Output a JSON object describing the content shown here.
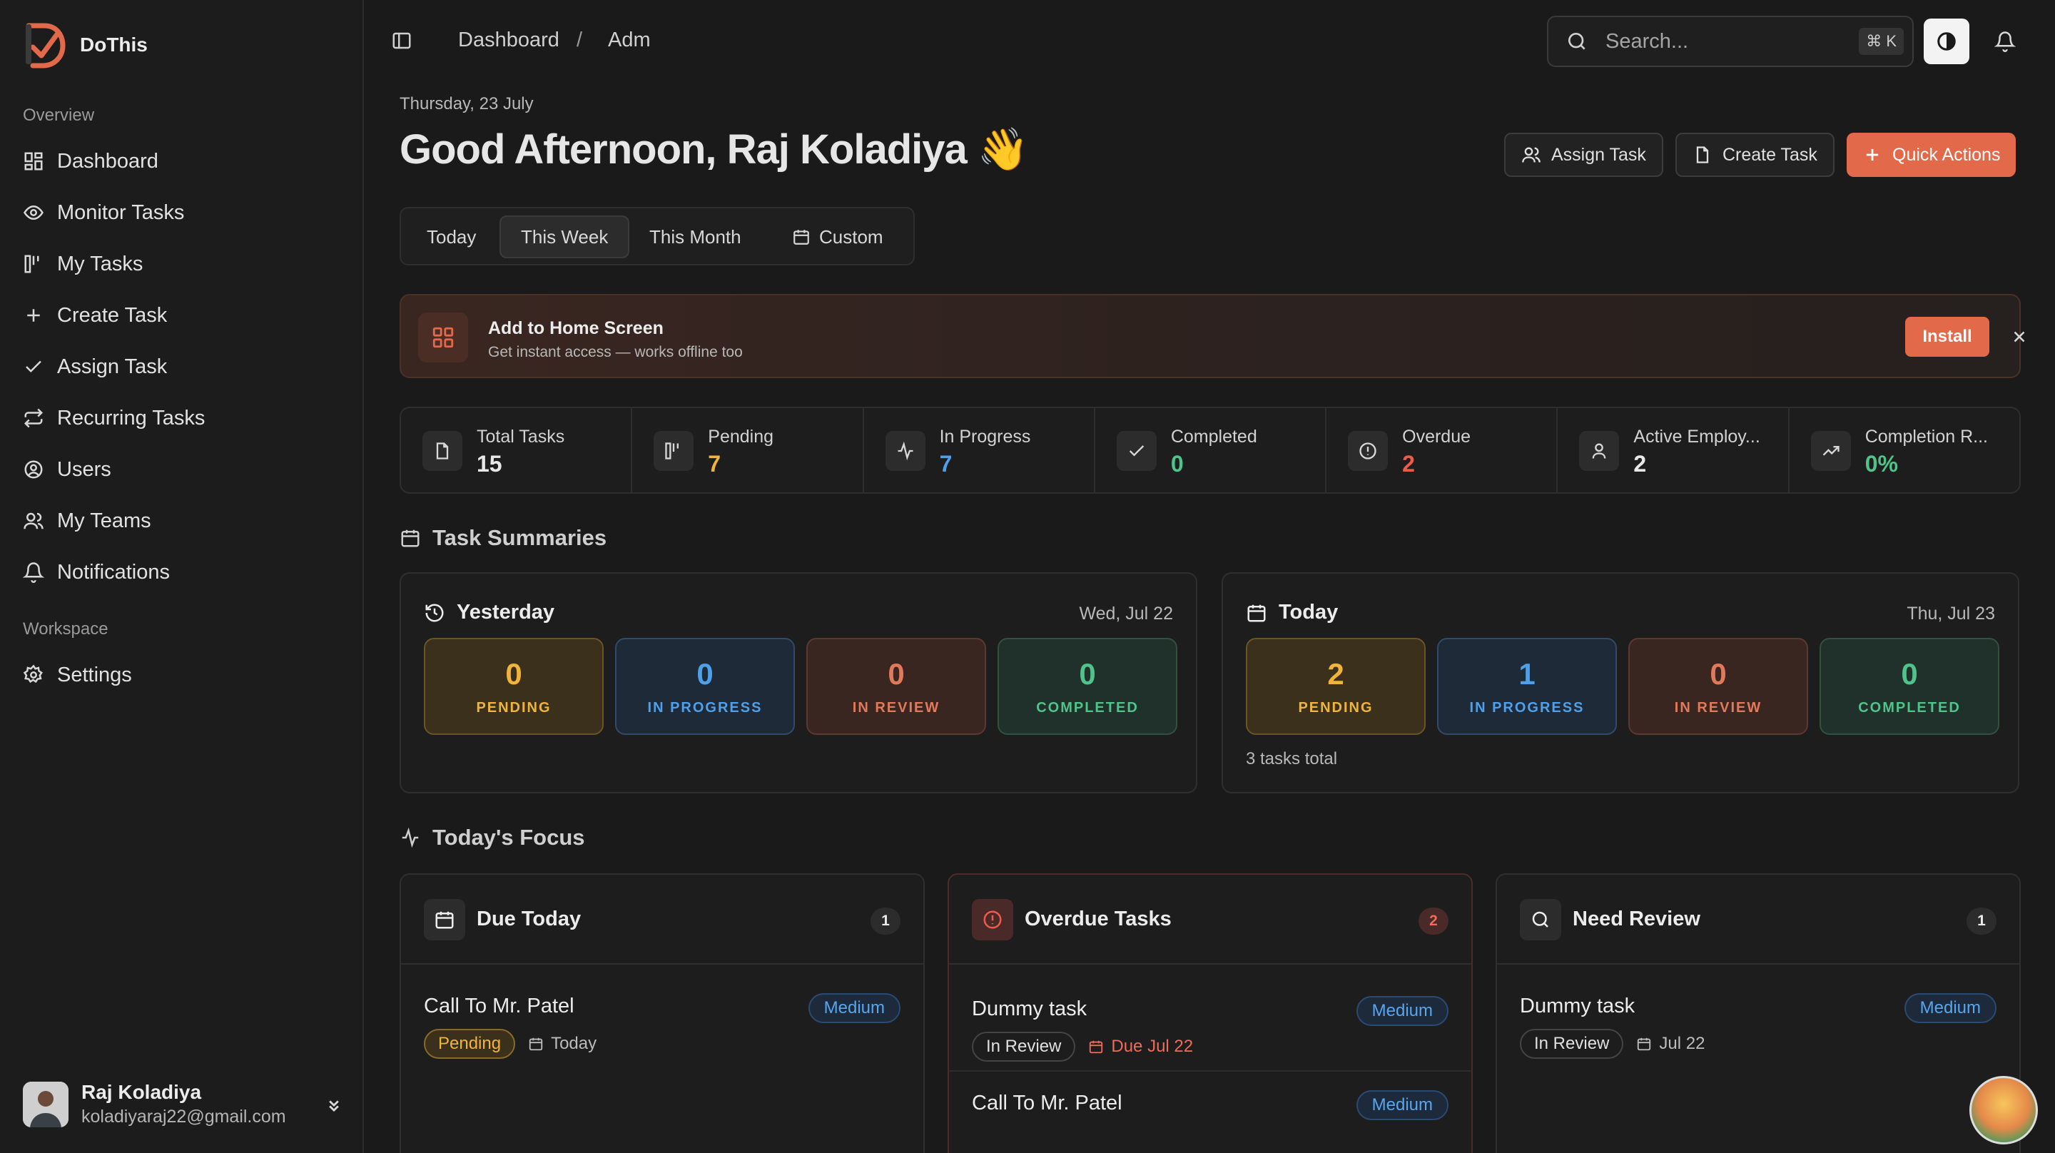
{
  "app": {
    "name": "DoThis",
    "brand_color": "#e3694b"
  },
  "sidebar": {
    "overview_label": "Overview",
    "workspace_label": "Workspace",
    "items": [
      {
        "label": "Dashboard",
        "icon": "dashboard-icon"
      },
      {
        "label": "Monitor Tasks",
        "icon": "eye-icon"
      },
      {
        "label": "My Tasks",
        "icon": "kanban-icon"
      },
      {
        "label": "Create Task",
        "icon": "plus-icon"
      },
      {
        "label": "Assign Task",
        "icon": "check-icon"
      },
      {
        "label": "Recurring Tasks",
        "icon": "repeat-icon"
      },
      {
        "label": "Users",
        "icon": "user-circle-icon"
      },
      {
        "label": "My Teams",
        "icon": "users-icon"
      },
      {
        "label": "Notifications",
        "icon": "bell-icon"
      }
    ],
    "workspace_items": [
      {
        "label": "Settings",
        "icon": "gear-icon"
      }
    ],
    "user": {
      "name": "Raj Koladiya",
      "email": "koladiyaraj22@gmail.com"
    }
  },
  "topbar": {
    "breadcrumb": [
      "Dashboard",
      "/",
      "Adm"
    ],
    "search_placeholder": "Search...",
    "shortcut": "⌘ K"
  },
  "header": {
    "date": "Thursday, 23 July",
    "greeting": "Good Afternoon, Raj Koladiya 👋",
    "assign_label": "Assign Task",
    "create_label": "Create Task",
    "quick_label": "Quick Actions"
  },
  "tabs": {
    "items": [
      "Today",
      "This Week",
      "This Month",
      "Custom"
    ],
    "active": "This Week"
  },
  "pwa": {
    "title": "Add to Home Screen",
    "subtitle": "Get instant access — works offline too",
    "install_label": "Install"
  },
  "stats": [
    {
      "label": "Total Tasks",
      "value": "15",
      "color": "#e8e8e8"
    },
    {
      "label": "Pending",
      "value": "7",
      "color": "#f0b43a"
    },
    {
      "label": "In Progress",
      "value": "7",
      "color": "#4fa0ea"
    },
    {
      "label": "Completed",
      "value": "0",
      "color": "#4fc48a"
    },
    {
      "label": "Overdue",
      "value": "2",
      "color": "#ef5b4a"
    },
    {
      "label": "Active Employ...",
      "value": "2",
      "color": "#e8e8e8"
    },
    {
      "label": "Completion R...",
      "value": "0%",
      "color": "#4fc48a"
    }
  ],
  "summaries": {
    "title": "Task Summaries",
    "yesterday": {
      "title": "Yesterday",
      "date": "Wed, Jul 22",
      "tiles": [
        {
          "num": "0",
          "label": "PENDING"
        },
        {
          "num": "0",
          "label": "IN PROGRESS"
        },
        {
          "num": "0",
          "label": "IN REVIEW"
        },
        {
          "num": "0",
          "label": "COMPLETED"
        }
      ]
    },
    "today": {
      "title": "Today",
      "date": "Thu, Jul 23",
      "tiles": [
        {
          "num": "2",
          "label": "PENDING"
        },
        {
          "num": "1",
          "label": "IN PROGRESS"
        },
        {
          "num": "0",
          "label": "IN REVIEW"
        },
        {
          "num": "0",
          "label": "COMPLETED"
        }
      ],
      "footer": "3 tasks total"
    }
  },
  "focus": {
    "title": "Today's Focus",
    "due_today": {
      "title": "Due Today",
      "count": "1",
      "tasks": [
        {
          "name": "Call To Mr. Patel",
          "priority": "Medium",
          "status": "Pending",
          "date": "Today"
        }
      ]
    },
    "overdue": {
      "title": "Overdue Tasks",
      "count": "2",
      "tasks": [
        {
          "name": "Dummy task",
          "priority": "Medium",
          "status": "In Review",
          "date": "Due Jul 22"
        },
        {
          "name": "Call To Mr. Patel",
          "priority": "Medium"
        }
      ]
    },
    "need_review": {
      "title": "Need Review",
      "count": "1",
      "tasks": [
        {
          "name": "Dummy task",
          "priority": "Medium",
          "status": "In Review",
          "date": "Jul 22"
        }
      ]
    }
  }
}
